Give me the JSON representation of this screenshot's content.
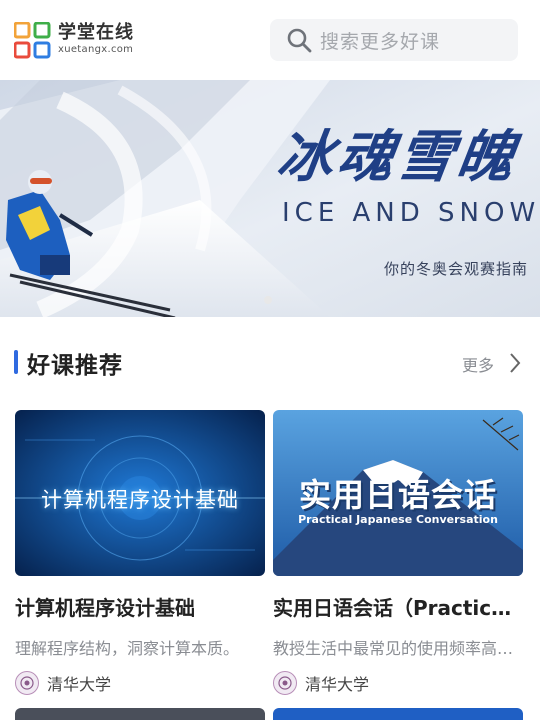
{
  "header": {
    "logo_cn": "学堂在线",
    "logo_en": "xuetangx.com",
    "search_placeholder": "搜索更多好课"
  },
  "banner": {
    "title": "冰魂雪魄",
    "subtitle": "ICE AND SNOW",
    "tagline": "你的冬奥会观赛指南",
    "active_dot": 0
  },
  "section": {
    "title": "好课推荐",
    "more_label": "更多"
  },
  "courses": [
    {
      "title": "计算机程序设计基础",
      "thumb_text": "计算机程序设计基础",
      "description": "理解程序结构，洞察计算本质。",
      "school": "清华大学"
    },
    {
      "title": "实用日语会话（Practical Japanese Conversation）",
      "thumb_text": "实用日语会话",
      "thumb_subtext": "Practical Japanese Conversation",
      "description": "教授生活中最常见的使用频率高的日语会话",
      "school": "清华大学"
    }
  ],
  "colors": {
    "accent": "#2f6ae0",
    "banner_title": "#1f3f86"
  }
}
